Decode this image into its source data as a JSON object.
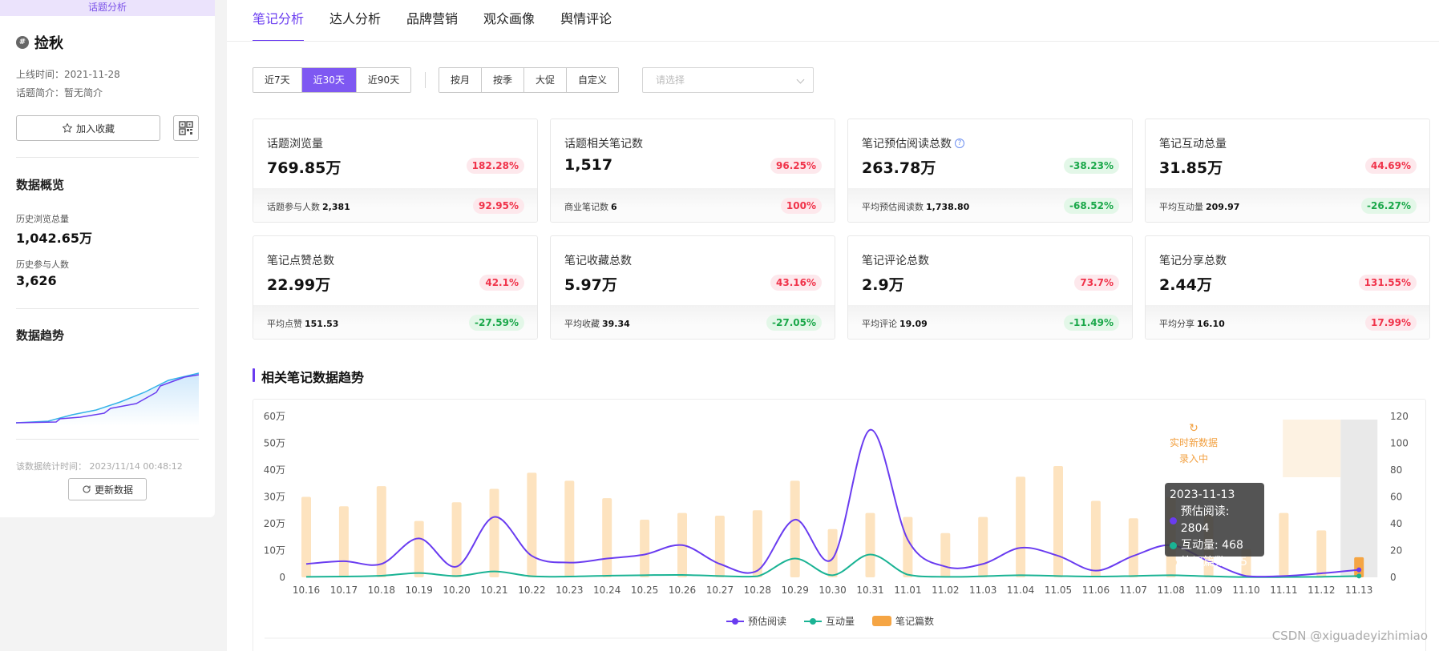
{
  "sidebar": {
    "banner": "话题分析",
    "topic_name": "捡秋",
    "launch_time": "上线时间：2021-11-28",
    "intro": "话题简介：暂无简介",
    "fav_label": "加入收藏",
    "overview_title": "数据概览",
    "total_views_label": "历史浏览总量",
    "total_views_value": "1,042.65万",
    "participants_label": "历史参与人数",
    "participants_value": "3,626",
    "trend_title": "数据趋势",
    "stat_time": "该数据统计时间：  2023/11/14 00:48:12",
    "refresh_label": "更新数据"
  },
  "tabs": [
    "笔记分析",
    "达人分析",
    "品牌营销",
    "观众画像",
    "舆情评论"
  ],
  "filters": {
    "range": [
      "近7天",
      "近30天",
      "近90天"
    ],
    "period": [
      "按月",
      "按季",
      "大促",
      "自定义"
    ],
    "select_placeholder": "请选择"
  },
  "cards": [
    {
      "title": "话题浏览量",
      "value": "769.85万",
      "change": "182.28%",
      "sub_label": "话题参与人数",
      "sub_value": "2,381",
      "sub_change": "92.95%"
    },
    {
      "title": "话题相关笔记数",
      "value": "1,517",
      "change": "96.25%",
      "sub_label": "商业笔记数",
      "sub_value": "6",
      "sub_change": "100%"
    },
    {
      "title": "笔记预估阅读总数",
      "value": "263.78万",
      "change": "-38.23%",
      "sub_label": "平均预估阅读数",
      "sub_value": "1,738.80",
      "sub_change": "-68.52%"
    },
    {
      "title": "笔记互动总量",
      "value": "31.85万",
      "change": "44.69%",
      "sub_label": "平均互动量",
      "sub_value": "209.97",
      "sub_change": "-26.27%"
    },
    {
      "title": "笔记点赞总数",
      "value": "22.99万",
      "change": "42.1%",
      "sub_label": "平均点赞",
      "sub_value": "151.53",
      "sub_change": "-27.59%"
    },
    {
      "title": "笔记收藏总数",
      "value": "5.97万",
      "change": "43.16%",
      "sub_label": "平均收藏",
      "sub_value": "39.34",
      "sub_change": "-27.05%"
    },
    {
      "title": "笔记评论总数",
      "value": "2.9万",
      "change": "73.7%",
      "sub_label": "平均评论",
      "sub_value": "19.09",
      "sub_change": "-11.49%"
    },
    {
      "title": "笔记分享总数",
      "value": "2.44万",
      "change": "131.55%",
      "sub_label": "平均分享",
      "sub_value": "16.10",
      "sub_change": "17.99%"
    }
  ],
  "section_title": "相关笔记数据趋势",
  "colors": {
    "accent": "#6a3cf0",
    "read": "#6a3cf0",
    "interact": "#1ab394",
    "notes": "#fde3bf",
    "notes_highlight": "#f5a544",
    "up": "#f0334a",
    "down": "#1ba84a"
  },
  "chart_data": {
    "type": "bar",
    "categories": [
      "10.16",
      "10.17",
      "10.18",
      "10.19",
      "10.20",
      "10.21",
      "10.22",
      "10.23",
      "10.24",
      "10.25",
      "10.26",
      "10.27",
      "10.28",
      "10.29",
      "10.30",
      "10.31",
      "11.01",
      "11.02",
      "11.03",
      "11.04",
      "11.05",
      "11.06",
      "11.07",
      "11.08",
      "11.09",
      "11.10",
      "11.11",
      "11.12",
      "11.13"
    ],
    "series": [
      {
        "name": "预估阅读",
        "type": "line",
        "axis": "left",
        "values": [
          5000,
          6000,
          5000,
          14500,
          4000,
          22500,
          8000,
          5500,
          7000,
          8500,
          12000,
          5000,
          2500,
          21500,
          7000,
          55000,
          14000,
          4000,
          5000,
          11000,
          8000,
          2500,
          8000,
          12000,
          6000,
          500,
          500,
          1500,
          2804
        ]
      },
      {
        "name": "互动量",
        "type": "line",
        "axis": "left",
        "values": [
          200,
          300,
          600,
          1600,
          500,
          2200,
          400,
          300,
          600,
          800,
          900,
          500,
          400,
          7000,
          800,
          8500,
          1000,
          200,
          400,
          800,
          500,
          300,
          500,
          800,
          400,
          100,
          100,
          200,
          468
        ]
      },
      {
        "name": "笔记篇数",
        "type": "bar",
        "axis": "right",
        "values": [
          60,
          53,
          68,
          42,
          56,
          66,
          78,
          72,
          59,
          43,
          48,
          46,
          50,
          72,
          36,
          48,
          45,
          33,
          45,
          75,
          83,
          57,
          44,
          60,
          47,
          21,
          48,
          35,
          15
        ]
      }
    ],
    "y_left_ticks": [
      "0",
      "10万",
      "20万",
      "30万",
      "40万",
      "50万",
      "60万"
    ],
    "y_left_max": 60000,
    "y_right_ticks": [
      "0",
      "20",
      "40",
      "60",
      "80",
      "100",
      "120"
    ],
    "y_right_max": 120,
    "legend_position": "bottom-center",
    "tooltip": {
      "date": "2023-11-13",
      "rows": [
        "预估阅读: 2804",
        "互动量: 468",
        "笔记篇数: 15"
      ]
    },
    "live_label_1": "实时新数据",
    "live_label_2": "录入中"
  },
  "watermark": "CSDN @xiguadeyizhimiao"
}
